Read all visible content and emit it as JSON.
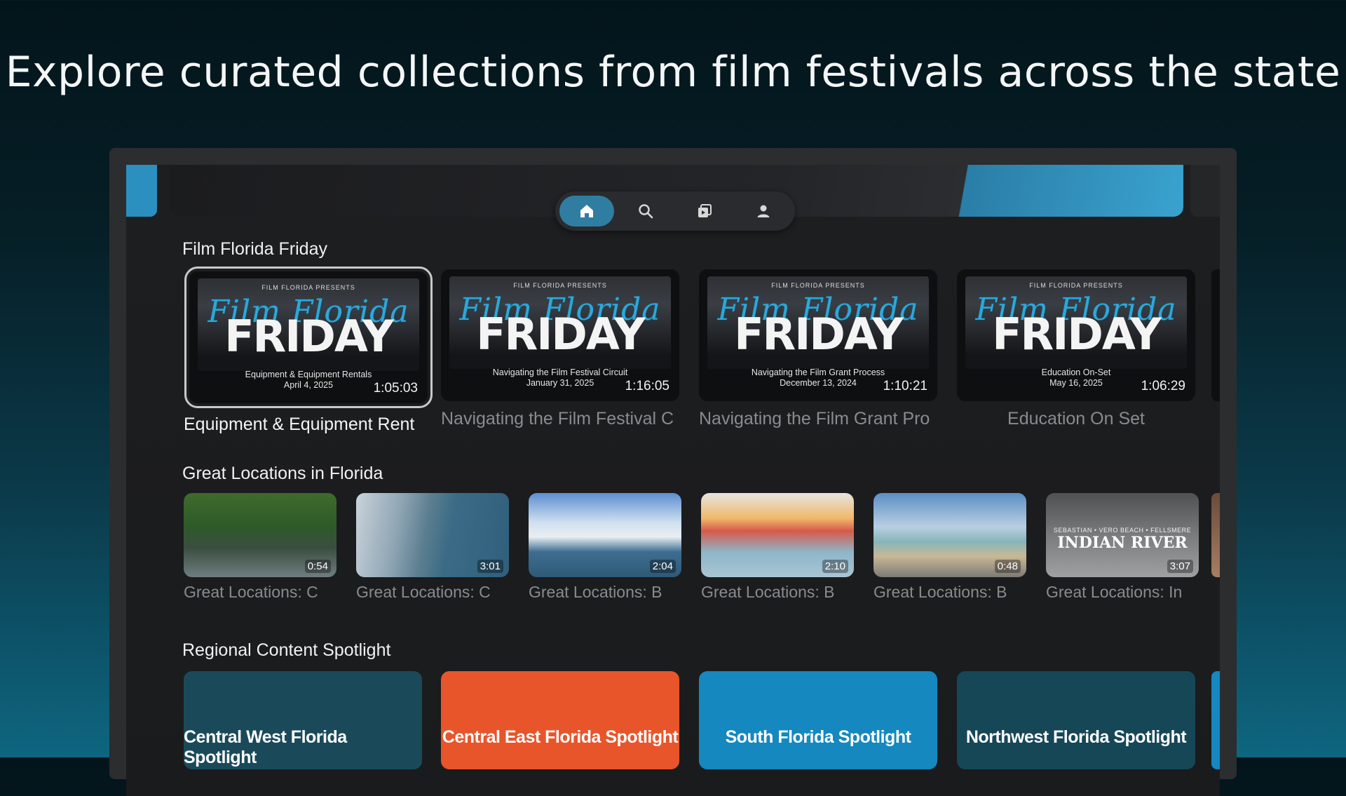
{
  "headline": "Explore curated collections from film festivals across the state",
  "nav": {
    "items": [
      {
        "icon": "home-icon",
        "active": true
      },
      {
        "icon": "search-icon",
        "active": false
      },
      {
        "icon": "library-icon",
        "active": false
      },
      {
        "icon": "profile-icon",
        "active": false
      }
    ],
    "accent": "#2f7ea1"
  },
  "sections": {
    "film_florida_friday": {
      "title": "Film Florida Friday",
      "art": {
        "logo": "FILM FLORIDA  PRESENTS",
        "script": "Film Florida",
        "big": "FRIDAY"
      },
      "cards": [
        {
          "sub1": "Equipment & Equipment Rentals",
          "sub2": "April 4, 2025",
          "duration": "1:05:03",
          "caption": "Equipment & Equipment Rent"
        },
        {
          "sub1": "Navigating the Film Festival Circuit",
          "sub2": "January 31, 2025",
          "duration": "1:16:05",
          "caption": "Navigating the Film Festival C"
        },
        {
          "sub1": "Navigating the Film Grant Process",
          "sub2": "December 13, 2024",
          "duration": "1:10:21",
          "caption": "Navigating the Film Grant Pro"
        },
        {
          "sub1": "Education On-Set",
          "sub2": "May 16, 2025",
          "duration": "1:06:29",
          "caption": "Education On Set"
        }
      ]
    },
    "great_locations": {
      "title": "Great Locations in Florida",
      "cards": [
        {
          "duration": "0:54",
          "caption": "Great Locations: C"
        },
        {
          "duration": "3:01",
          "caption": "Great Locations: C"
        },
        {
          "duration": "2:04",
          "caption": "Great Locations: B"
        },
        {
          "duration": "2:10",
          "caption": "Great Locations: B"
        },
        {
          "duration": "0:48",
          "caption": "Great Locations: B"
        },
        {
          "duration": "3:07",
          "caption": "Great Locations: In",
          "overlay_small": "SEBASTIAN • VERO BEACH • FELLSMERE",
          "overlay_big": "INDIAN RIVER"
        }
      ]
    },
    "regional": {
      "title": "Regional Content Spotlight",
      "cards": [
        {
          "label": "Central West Florida Spotlight",
          "color": "#1a4a5a"
        },
        {
          "label": "Central East Florida Spotlight",
          "color": "#e8552b"
        },
        {
          "label": "South Florida Spotlight",
          "color": "#1488bf"
        },
        {
          "label": "Northwest Florida Spotlight",
          "color": "#154757"
        }
      ]
    }
  }
}
